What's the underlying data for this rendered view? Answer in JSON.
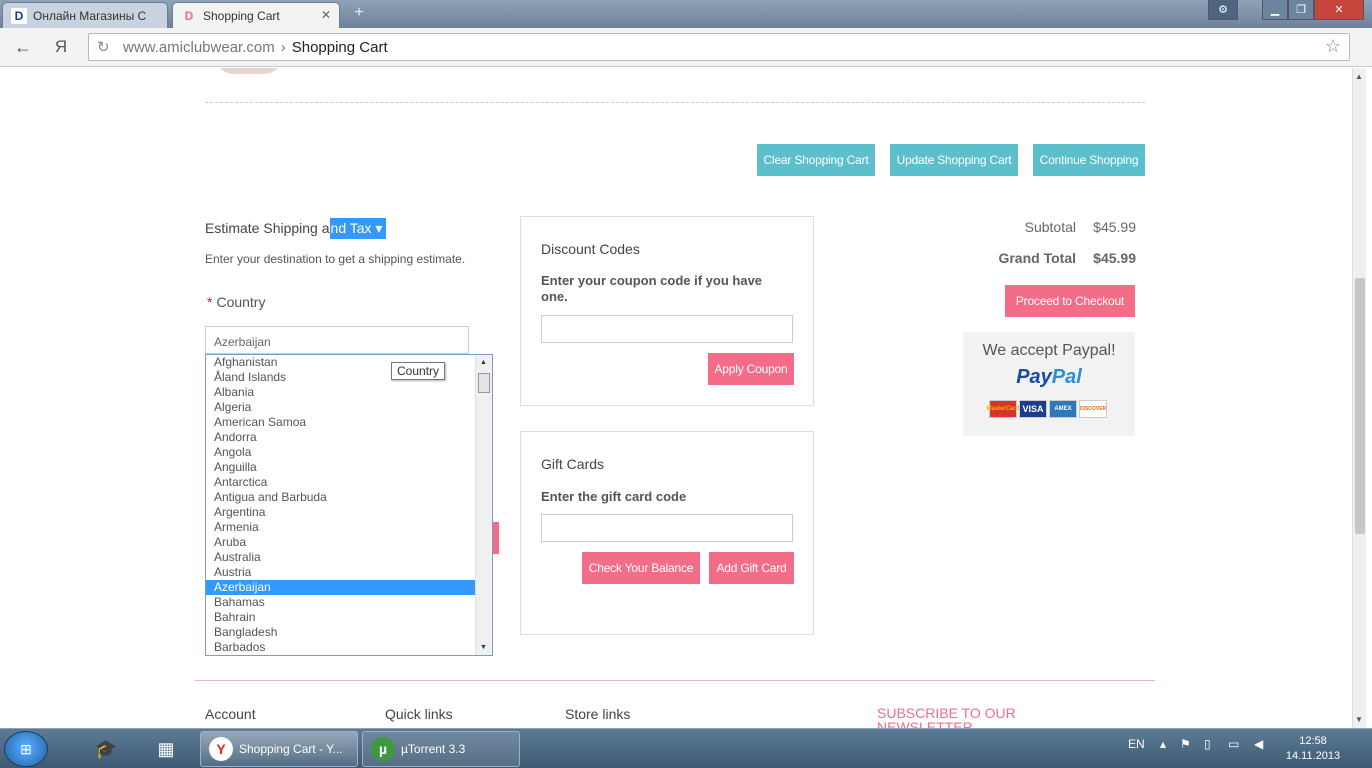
{
  "browser": {
    "tabs": [
      {
        "label": "Онлайн Магазины С",
        "favicon": "D"
      },
      {
        "label": "Shopping Cart",
        "favicon": "D"
      }
    ],
    "new_tab_icon": "+",
    "url_host": "www.amiclubwear.com",
    "url_separator": "›",
    "url_path": "Shopping Cart",
    "back_icon": "←",
    "yandex_icon": "Я",
    "reload_icon": "↻",
    "star_icon": "☆",
    "settings_icon": "⚙",
    "min_icon": "▁",
    "max_icon": "❐",
    "close_icon": "✕"
  },
  "cart_actions": {
    "clear": "Clear Shopping Cart",
    "update": "Update Shopping Cart",
    "continue": "Continue Shopping"
  },
  "estimate": {
    "title_prefix": "Estimate Shipping a",
    "title_highlight": "nd Tax ▾",
    "description": "Enter your destination to get a shipping estimate.",
    "required_mark": "*",
    "country_label": "Country",
    "country_value": "Azerbaijan",
    "tooltip": "Country",
    "countries": [
      "Afghanistan",
      "Åland Islands",
      "Albania",
      "Algeria",
      "American Samoa",
      "Andorra",
      "Angola",
      "Anguilla",
      "Antarctica",
      "Antigua and Barbuda",
      "Argentina",
      "Armenia",
      "Aruba",
      "Australia",
      "Austria",
      "Azerbaijan",
      "Bahamas",
      "Bahrain",
      "Bangladesh",
      "Barbados"
    ],
    "selected_country": "Azerbaijan"
  },
  "discount": {
    "heading": "Discount Codes",
    "label": "Enter your coupon code if you have one.",
    "input_value": "",
    "apply_button": "Apply Coupon"
  },
  "gift": {
    "heading": "Gift Cards",
    "label": "Enter the gift card code",
    "input_value": "",
    "check_button": "Check Your Balance",
    "add_button": "Add Gift Card"
  },
  "totals": {
    "subtotal_label": "Subtotal",
    "subtotal_value": "$45.99",
    "grand_label": "Grand Total",
    "grand_value": "$45.99",
    "checkout_button": "Proceed to Checkout"
  },
  "payment": {
    "heading": "We accept Paypal!",
    "logo_pay": "Pay",
    "logo_pal": "Pal",
    "cards": [
      "MasterCard",
      "VISA",
      "AMEX",
      "DISCOVER"
    ]
  },
  "footer": {
    "account": "Account",
    "quick_links": "Quick links",
    "store_links": "Store links",
    "subscribe": "SUBSCRIBE TO OUR NEWSLETTER"
  },
  "taskbar": {
    "tasks": [
      {
        "label": "Shopping Cart - Y...",
        "icon": "Y"
      },
      {
        "label": "µTorrent 3.3",
        "icon": "µ"
      }
    ],
    "language": "EN",
    "time": "12:58",
    "date": "14.11.2013"
  },
  "colors": {
    "teal": "#5bc0cc",
    "pink": "#f46d88",
    "selection": "#3399ff"
  }
}
